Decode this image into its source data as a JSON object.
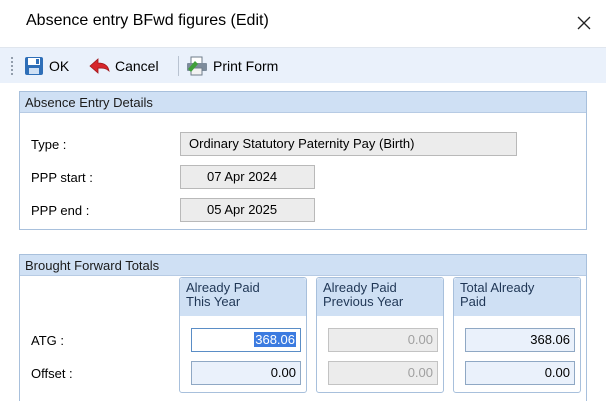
{
  "window": {
    "title": "Absence entry BFwd figures (Edit)",
    "close_glyph": "✕"
  },
  "toolbar": {
    "ok_label": "OK",
    "cancel_label": "Cancel",
    "print_label": "Print Form",
    "icons": {
      "ok": "save-disk-icon",
      "cancel": "back-arrow-icon",
      "print": "print-form-icon"
    }
  },
  "details": {
    "heading": "Absence Entry Details",
    "type_label": "Type :",
    "type_value": "Ordinary Statutory Paternity Pay (Birth)",
    "start_label": "PPP start :",
    "start_value": "07 Apr 2024",
    "end_label": "PPP end :",
    "end_value": "05 Apr 2025"
  },
  "totals": {
    "heading": "Brought Forward Totals",
    "columns": [
      {
        "line1": "Already Paid",
        "line2": "This Year"
      },
      {
        "line1": "Already Paid",
        "line2": "Previous Year"
      },
      {
        "line1": "Total Already",
        "line2": "Paid"
      }
    ],
    "rows": [
      {
        "label": "ATG :",
        "this_year": "368.06",
        "previous_year": "0.00",
        "total": "368.06"
      },
      {
        "label": "Offset :",
        "this_year": "0.00",
        "previous_year": "0.00",
        "total": "0.00"
      }
    ]
  },
  "colors": {
    "toolbar_bg": "#eaf1fb",
    "group_header_bg": "#cfe0f4",
    "selection": "#3c7be0"
  }
}
